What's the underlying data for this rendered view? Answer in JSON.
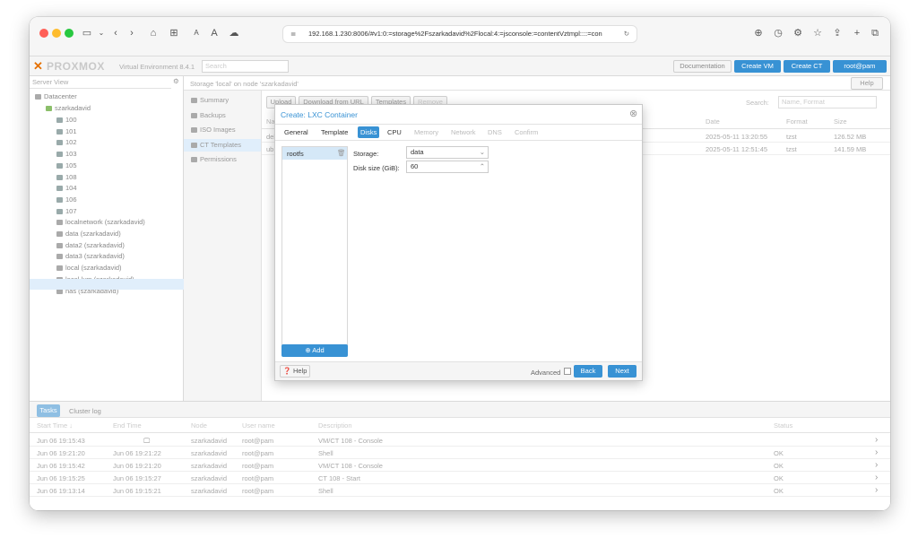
{
  "browser": {
    "url": "192.168.1.230:8006/#v1:0:=storage%2Fszarkadavid%2Flocal:4:=jsconsole:=contentVztmpl::::=con"
  },
  "pve": {
    "logo": "PROXMOX",
    "env": "Virtual Environment 8.4.1",
    "search_placeholder": "Search",
    "documentation": "Documentation",
    "create_vm": "Create VM",
    "create_ct": "Create CT",
    "user": "root@pam",
    "server_view": "Server View",
    "tree": {
      "datacenter": "Datacenter",
      "node": "szarkadavid",
      "items": [
        "100",
        "101",
        "102",
        "103",
        "105",
        "108",
        "104",
        "106",
        "107",
        "localnetwork (szarkadavid)",
        "data (szarkadavid)",
        "data2 (szarkadavid)",
        "data3 (szarkadavid)",
        "local (szarkadavid)",
        "local-lvm (szarkadavid)",
        "nas (szarkadavid)"
      ]
    },
    "content_title": "Storage 'local' on node 'szarkadavid'",
    "help": "Help",
    "side_menu": [
      "Summary",
      "Backups",
      "ISO Images",
      "CT Templates",
      "Permissions"
    ],
    "toolbar": {
      "upload": "Upload",
      "download": "Download from URL",
      "templates": "Templates",
      "remove": "Remove",
      "search_label": "Search:",
      "search_placeholder": "Name, Format"
    },
    "grid": {
      "cols": [
        "Name",
        "Date",
        "Format",
        "Size"
      ],
      "rows": [
        [
          "debian-12-standard_12.7-1_amd64.tar.zst",
          "2025-05-11 13:20:55",
          "tzst",
          "126.52 MB"
        ],
        [
          "ub",
          "2025-05-11 12:51:45",
          "tzst",
          "141.59 MB"
        ]
      ]
    },
    "tasks": {
      "tab_tasks": "Tasks",
      "tab_cluster": "Cluster log",
      "cols": [
        "Start Time ↓",
        "End Time",
        "Node",
        "User name",
        "Description",
        "Status"
      ],
      "rows": [
        [
          "Jun 06 19:15:43",
          "",
          "szarkadavid",
          "root@pam",
          "VM/CT 108 - Console",
          ""
        ],
        [
          "Jun 06 19:21:20",
          "Jun 06 19:21:22",
          "szarkadavid",
          "root@pam",
          "Shell",
          "OK"
        ],
        [
          "Jun 06 19:15:42",
          "Jun 06 19:21:20",
          "szarkadavid",
          "root@pam",
          "VM/CT 108 - Console",
          "OK"
        ],
        [
          "Jun 06 19:15:25",
          "Jun 06 19:15:27",
          "szarkadavid",
          "root@pam",
          "CT 108 - Start",
          "OK"
        ],
        [
          "Jun 06 19:13:14",
          "Jun 06 19:15:21",
          "szarkadavid",
          "root@pam",
          "Shell",
          "OK"
        ]
      ]
    }
  },
  "dialog": {
    "title": "Create: LXC Container",
    "tabs": [
      "General",
      "Template",
      "Disks",
      "CPU",
      "Memory",
      "Network",
      "DNS",
      "Confirm"
    ],
    "disk_item": "rootfs",
    "storage_label": "Storage:",
    "storage_value": "data",
    "size_label": "Disk size (GiB):",
    "size_value": "60",
    "add": "Add",
    "help": "Help",
    "advanced": "Advanced",
    "back": "Back",
    "next": "Next"
  }
}
